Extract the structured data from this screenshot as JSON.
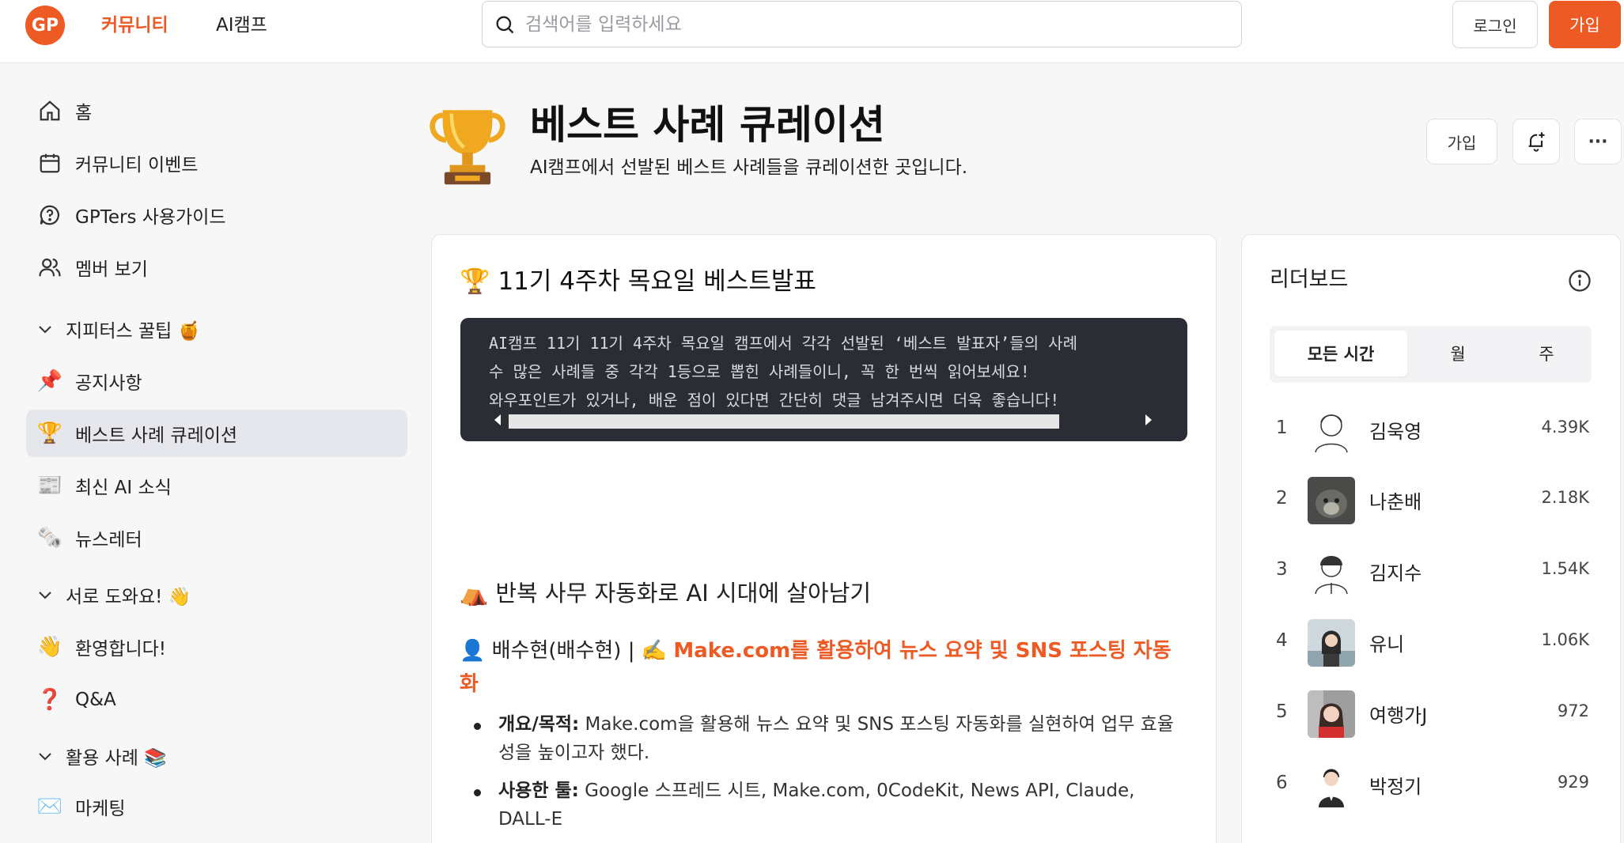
{
  "header": {
    "logo_text": "GP",
    "nav": [
      {
        "label": "커뮤니티",
        "active": true
      },
      {
        "label": "AI캠프",
        "active": false
      }
    ],
    "search_placeholder": "검색어를 입력하세요",
    "login_label": "로그인",
    "join_label": "가입"
  },
  "sidebar": {
    "items": [
      {
        "label": "홈",
        "icon": "home-icon"
      },
      {
        "label": "커뮤니티 이벤트",
        "icon": "calendar-icon"
      },
      {
        "label": "GPTers 사용가이드",
        "icon": "help-bubble-icon"
      },
      {
        "label": "멤버 보기",
        "icon": "members-icon"
      }
    ],
    "group_tips": "지피터스 꿀팁 🍯",
    "tips_items": [
      {
        "label": "공지사항",
        "emoji": "📌"
      },
      {
        "label": "베스트 사례 큐레이션",
        "emoji": "🏆",
        "active": true
      },
      {
        "label": "최신 AI 소식",
        "emoji": "📰"
      },
      {
        "label": "뉴스레터",
        "emoji": "🗞️"
      }
    ],
    "group_help": "서로 도와요! 👋",
    "help_items": [
      {
        "label": "환영합니다!",
        "emoji": "👋"
      },
      {
        "label": "Q&A",
        "emoji": "❓"
      }
    ],
    "group_cases": "활용 사례 📚",
    "cases_items": [
      {
        "label": "마케팅",
        "emoji": "✉️"
      }
    ]
  },
  "page": {
    "title": "베스트 사례 큐레이션",
    "subtitle": "AI캠프에서 선발된 베스트 사례들을 큐레이션한 곳입니다.",
    "join_label": "가입",
    "more_label": "···"
  },
  "post": {
    "heading": "🏆 11기 4주차 목요일 베스트발표",
    "code_lines": [
      "AI캠프 11기 11기 4주차 목요일 캠프에서 각각 선발된 ‘베스트 발표자’들의 사례",
      "수 많은 사례들 중 각각 1등으로 뽑힌 사례들이니, 꼭 한 번씩 읽어보세요!",
      "와우포인트가 있거나, 배운 점이 있다면 간단히 댓글 남겨주시면 더욱 좋습니다!"
    ],
    "section_heading": "⛺ 반복 사무 자동화로 AI 시대에 살아남기",
    "author_prefix": "👤 배수현(배수현) | ✍️ ",
    "author_link": "Make.com를 활용하여 뉴스 요약 및 SNS 포스팅 자동화",
    "bullets": [
      {
        "label": "개요/목적:",
        "text": " Make.com을 활용해 뉴스 요약 및 SNS 포스팅 자동화를 실현하여 업무 효율성을 높이고자 했다."
      },
      {
        "label": "사용한 툴:",
        "text": " Google 스프레드 시트, Make.com, 0CodeKit, News API, Claude, DALL-E"
      }
    ]
  },
  "leaderboard": {
    "title": "리더보드",
    "tabs": [
      "모든 시간",
      "월",
      "주"
    ],
    "active_tab": 0,
    "rows": [
      {
        "rank": "1",
        "name": "김욱영",
        "points": "4.39K"
      },
      {
        "rank": "2",
        "name": "나춘배",
        "points": "2.18K"
      },
      {
        "rank": "3",
        "name": "김지수",
        "points": "1.54K"
      },
      {
        "rank": "4",
        "name": "유니",
        "points": "1.06K"
      },
      {
        "rank": "5",
        "name": "여행가J",
        "points": "972"
      },
      {
        "rank": "6",
        "name": "박정기",
        "points": "929"
      }
    ]
  },
  "colors": {
    "brand": "#ee5a24",
    "active_bg": "#e6e7ed",
    "code_bg": "#2a2d33"
  }
}
